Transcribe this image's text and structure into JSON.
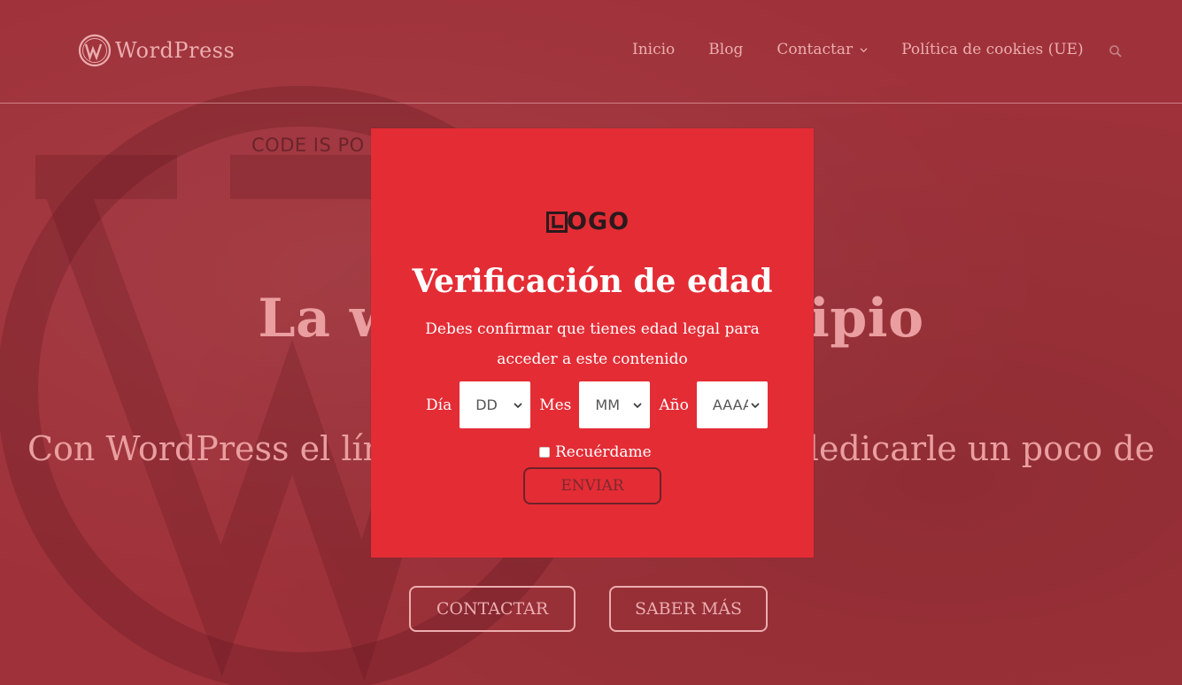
{
  "header": {
    "brand": "WordPress",
    "nav": [
      "Inicio",
      "Blog",
      "Contactar",
      "Política de cookies (UE)"
    ]
  },
  "background": {
    "code_text": "CODE IS PO"
  },
  "hero": {
    "title_left": "La w",
    "title_right": "cipio",
    "subtitle_left": "Con WordPress el lím",
    "subtitle_right": "dedicarle un poco de",
    "buttons": [
      "CONTACTAR",
      "SABER MÁS"
    ]
  },
  "modal": {
    "logo": "OGO",
    "title": "Verificación de edad",
    "description": "Debes confirmar que tienes edad legal para acceder a este contenido",
    "day_label": "Día",
    "day_value": "DD",
    "month_label": "Mes",
    "month_value": "MM",
    "year_label": "Año",
    "year_value": "AAAA",
    "remember_label": "Recuérdame",
    "submit_label": "ENVIAR"
  },
  "colors": {
    "modal_bg": "#e42c35",
    "page_bg": "#a2343c",
    "text_pink": "#f4b7b7"
  }
}
